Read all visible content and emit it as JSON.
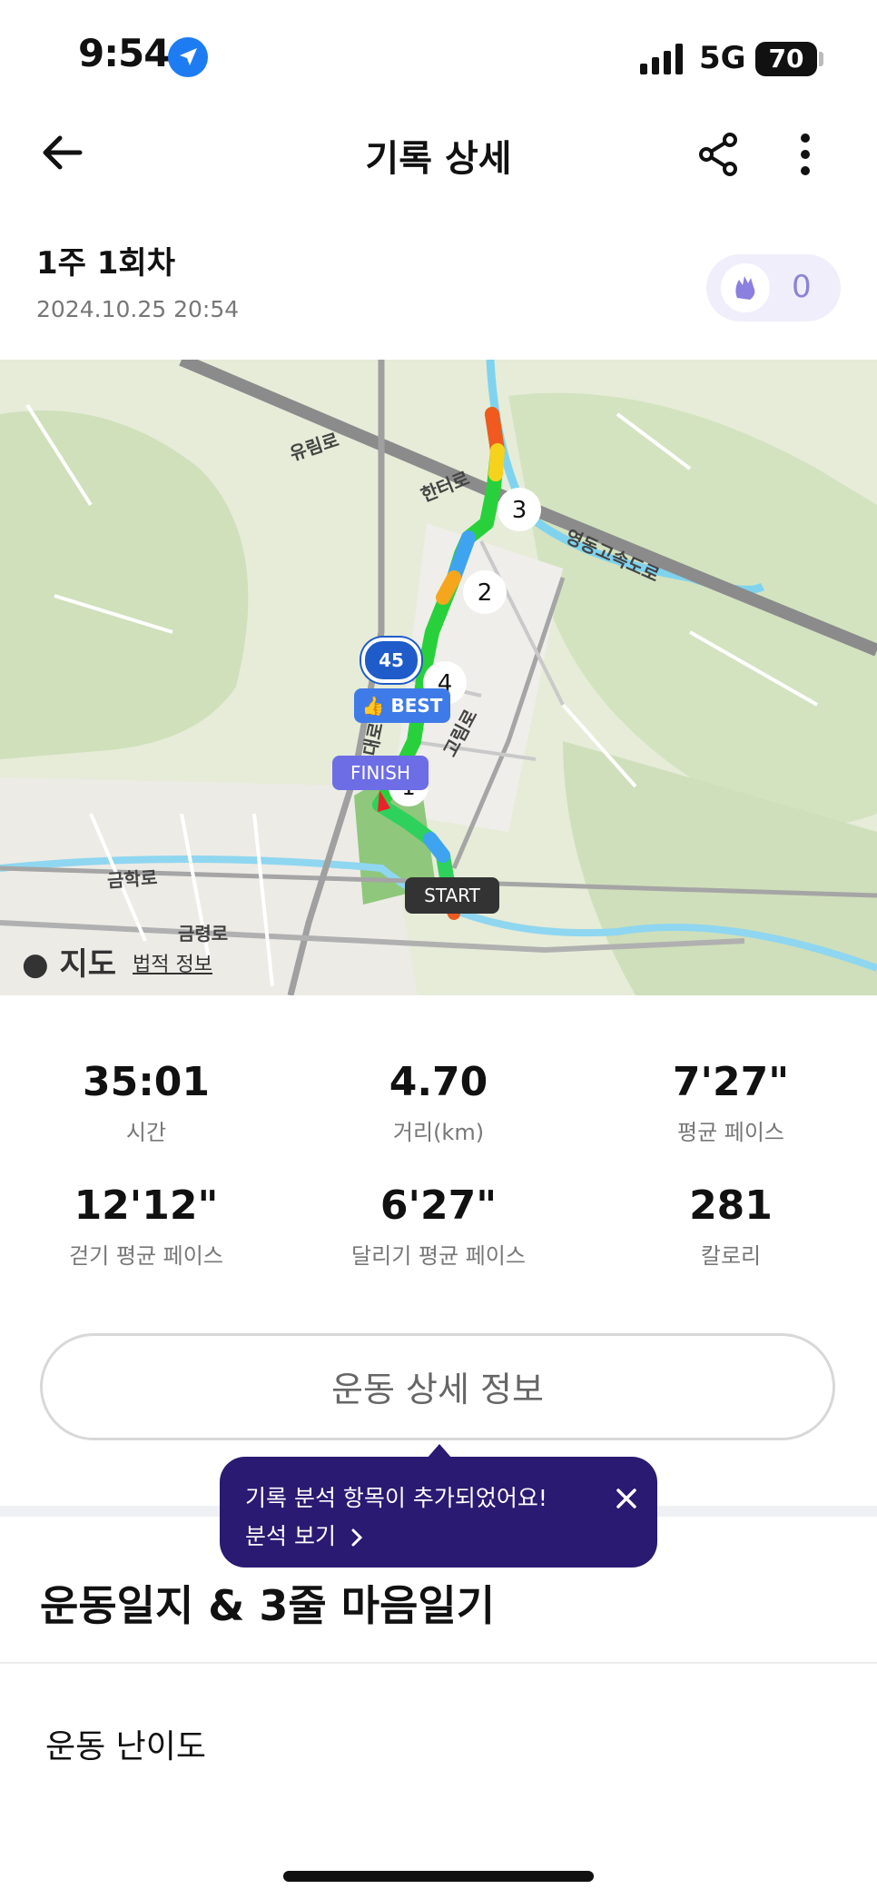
{
  "status_bar": {
    "time": "9:54",
    "network": "5G",
    "battery": "70"
  },
  "header": {
    "title": "기록 상세"
  },
  "record": {
    "title": "1주 1회차",
    "date": "2024.10.25 20:54",
    "claps": "0"
  },
  "map": {
    "road_labels": [
      "유림로",
      "한터로",
      "영동고속도로",
      "고림로",
      "금학로",
      "금령로",
      "용대로"
    ],
    "route_number": "45",
    "lap_markers": [
      "1",
      "2",
      "3",
      "4"
    ],
    "best_label": "BEST",
    "finish_label": "FINISH",
    "start_label": "START",
    "attribution": "지도",
    "legal": "법적 정보"
  },
  "stats": [
    {
      "value": "35:01",
      "label": "시간"
    },
    {
      "value": "4.70",
      "label": "거리(km)"
    },
    {
      "value": "7'27\"",
      "label": "평균 페이스"
    },
    {
      "value": "12'12\"",
      "label": "걷기 평균 페이스"
    },
    {
      "value": "6'27\"",
      "label": "달리기 평균 페이스"
    },
    {
      "value": "281",
      "label": "칼로리"
    }
  ],
  "detail_button": "운동 상세 정보",
  "tooltip": {
    "line1": "기록 분석 항목이 추가되었어요!",
    "line2": "분석 보기"
  },
  "journal": {
    "title": "운동일지 & 3줄 마음일기",
    "difficulty": "운동 난이도"
  },
  "colors": {
    "accent": "#2a1a72",
    "best": "#3f7be8",
    "finish": "#6d6de6"
  }
}
